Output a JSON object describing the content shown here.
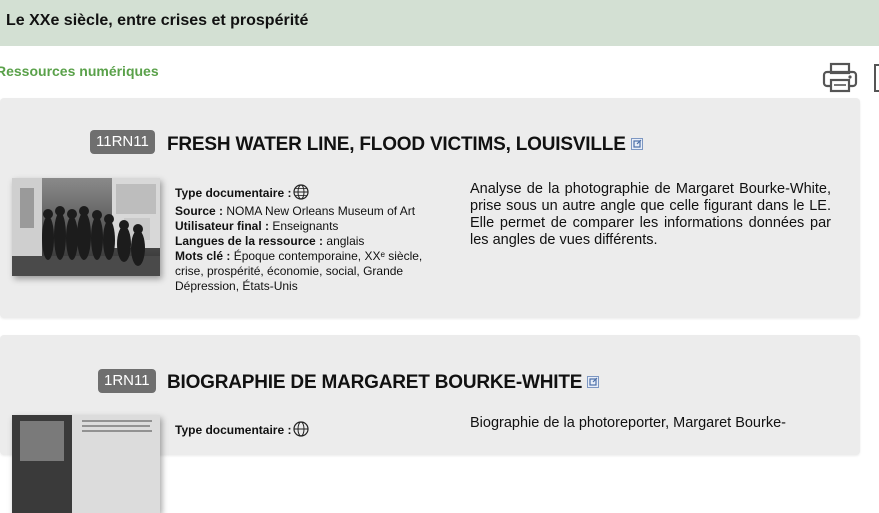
{
  "header": {
    "title": "Le XXe siècle, entre crises et prospérité"
  },
  "section": {
    "label": "Ressources numériques"
  },
  "toolbar": {
    "print_icon": "printer-icon"
  },
  "resources": [
    {
      "code": "11RN11",
      "title": "FRESH WATER LINE, FLOOD VICTIMS, LOUISVILLE",
      "type_label": "Type documentaire :",
      "source_label": "Source :",
      "source_value": "NOMA New Orleans Museum of Art",
      "user_label": "Utilisateur final :",
      "user_value": "Enseignants",
      "lang_label": "Langues de la ressource :",
      "lang_value": "anglais",
      "keywords_label": "Mots clé :",
      "keywords_value": "Époque contemporaine, XXᵉ siècle, crise, prospérité, économie, social, Grande Dépression, États-Unis",
      "description": "Analyse de la photographie de Margaret Bourke-White, prise sous un autre angle que celle figurant dans le LE. Elle permet de comparer les informations données par les angles de vues différents."
    },
    {
      "code": "1RN11",
      "title": "BIOGRAPHIE DE MARGARET BOURKE-WHITE",
      "type_label": "Type documentaire :",
      "description": "Biographie de la photoreporter, Margaret Bourke-"
    }
  ]
}
